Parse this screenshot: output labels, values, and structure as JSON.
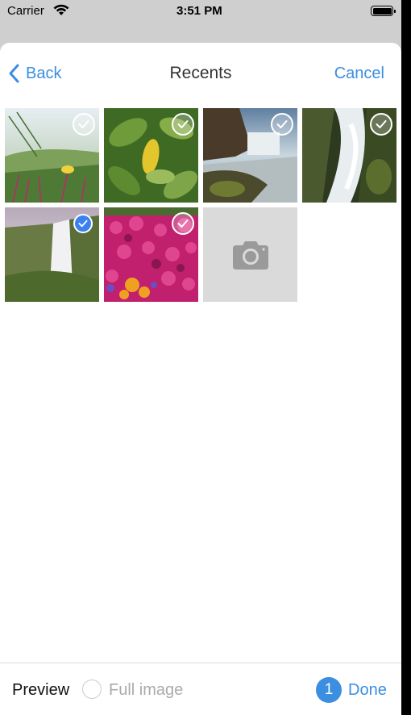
{
  "status_bar": {
    "carrier": "Carrier",
    "time": "3:51 PM",
    "wifi_icon": "wifi-icon",
    "battery_icon": "battery-icon"
  },
  "nav": {
    "back_label": "Back",
    "title": "Recents",
    "cancel_label": "Cancel"
  },
  "photos": [
    {
      "subject": "grass and flower field",
      "selected": false
    },
    {
      "subject": "green leaves",
      "selected": false
    },
    {
      "subject": "waterfall in canyon",
      "selected": false
    },
    {
      "subject": "cascading waterfall",
      "selected": false
    },
    {
      "subject": "tall waterfall with mist",
      "selected": true
    },
    {
      "subject": "pink flowers",
      "selected": false
    }
  ],
  "camera_tile": {
    "icon": "camera-icon"
  },
  "toolbar": {
    "preview_label": "Preview",
    "full_image_label": "Full image",
    "selected_count": "1",
    "done_label": "Done"
  },
  "colors": {
    "accent": "#3b8ee0",
    "selected_check": "#3b82f0"
  }
}
